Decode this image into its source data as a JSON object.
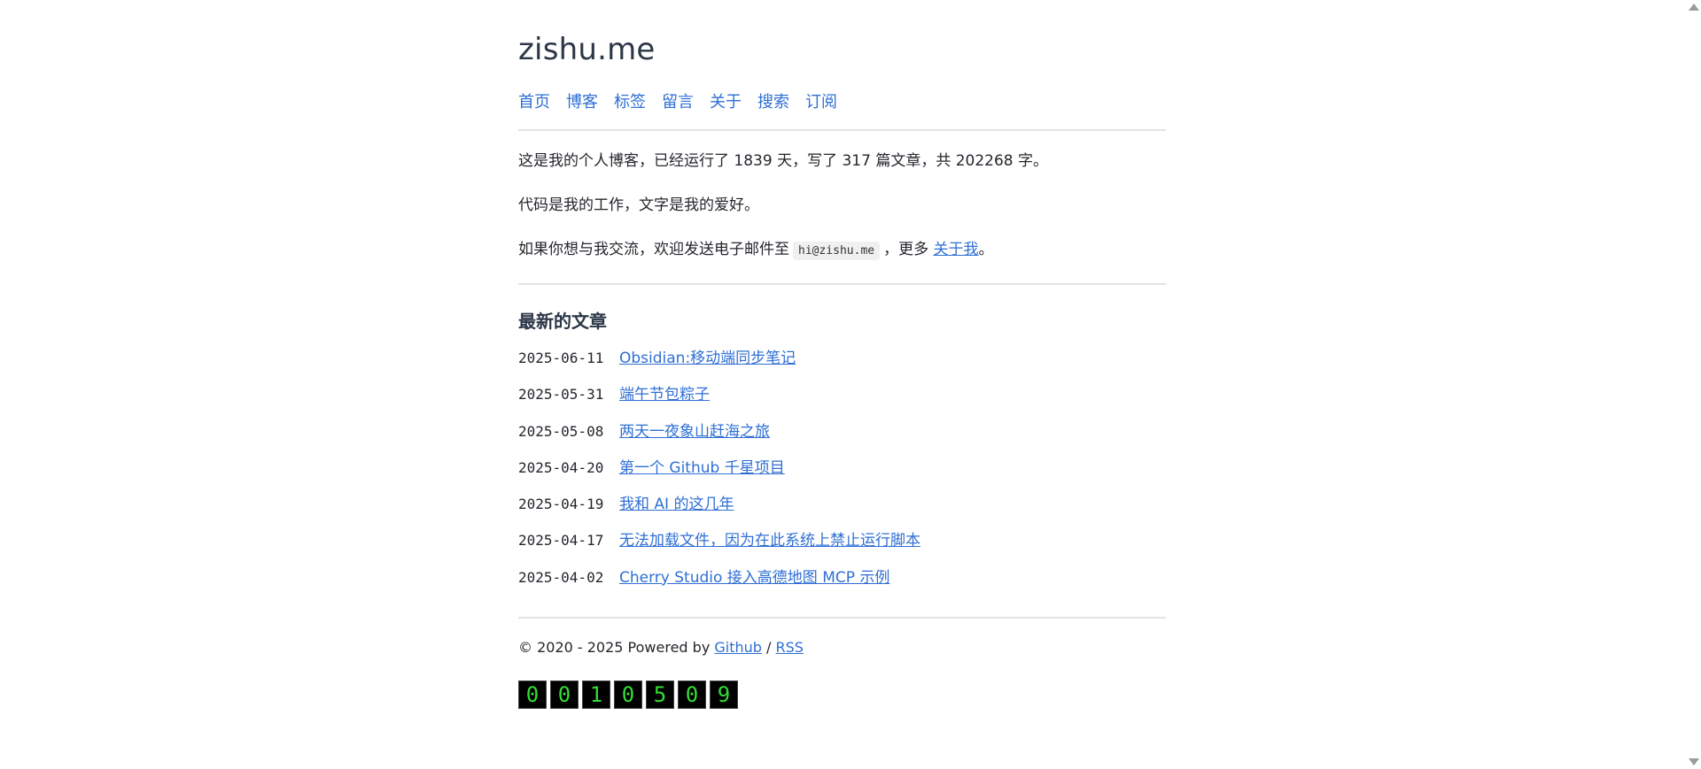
{
  "site": {
    "title": "zishu.me"
  },
  "nav": {
    "items": [
      {
        "label": "首页"
      },
      {
        "label": "博客"
      },
      {
        "label": "标签"
      },
      {
        "label": "留言"
      },
      {
        "label": "关于"
      },
      {
        "label": "搜索"
      },
      {
        "label": "订阅"
      }
    ]
  },
  "intro": {
    "line1": "这是我的个人博客，已经运行了 1839 天，写了 317 篇文章，共 202268 字。",
    "line2": "代码是我的工作，文字是我的爱好。",
    "line3_prefix": "如果你想与我交流，欢迎发送电子邮件至",
    "email": "hi@zishu.me",
    "line3_middle": "，更多",
    "about_link": "关于我",
    "line3_suffix": "。"
  },
  "latest": {
    "heading": "最新的文章",
    "posts": [
      {
        "date": "2025-06-11",
        "title": "Obsidian:移动端同步笔记"
      },
      {
        "date": "2025-05-31",
        "title": "端午节包粽子"
      },
      {
        "date": "2025-05-08",
        "title": "两天一夜象山赶海之旅"
      },
      {
        "date": "2025-04-20",
        "title": "第一个 Github 千星项目"
      },
      {
        "date": "2025-04-19",
        "title": "我和 AI 的这几年"
      },
      {
        "date": "2025-04-17",
        "title": "无法加载文件，因为在此系统上禁止运行脚本"
      },
      {
        "date": "2025-04-02",
        "title": "Cherry Studio 接入高德地图 MCP 示例"
      }
    ]
  },
  "footer": {
    "copyright": "© 2020 - 2025 Powered by",
    "github": "Github",
    "slash": "/",
    "rss": "RSS"
  },
  "counter": {
    "digits": [
      "0",
      "0",
      "1",
      "0",
      "5",
      "0",
      "9"
    ]
  },
  "colors": {
    "link": "#2f6fd4",
    "counter_digit": "#33dd33",
    "counter_bg": "#000000"
  }
}
